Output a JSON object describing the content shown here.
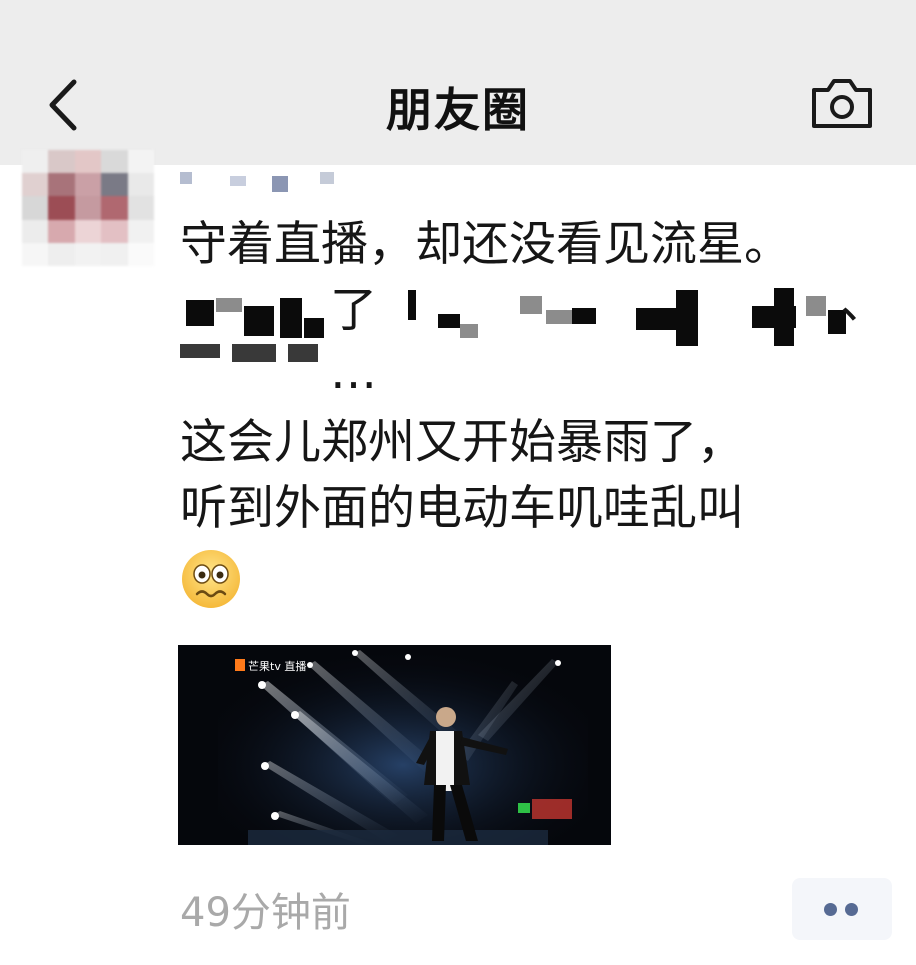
{
  "navbar": {
    "title": "朋友圈",
    "back_icon": "chevron-left-icon",
    "camera_icon": "camera-icon"
  },
  "post": {
    "line1": "守着直播，却还没看见流星。",
    "line2_visible": "了",
    "line2_end": "、",
    "line3_visible": "…",
    "line4": "这会儿郑州又开始暴雨了，",
    "line5": "听到外面的电动车叽哇乱叫",
    "emoji": "woozy-worried-face-emoji",
    "video_watermark": "芒果tv 直播",
    "timestamp": "49分钟前"
  },
  "colors": {
    "navbar_bg": "#ededed",
    "text": "#161616",
    "timestamp": "#a9a9a9",
    "more_dots": "#566a93"
  }
}
